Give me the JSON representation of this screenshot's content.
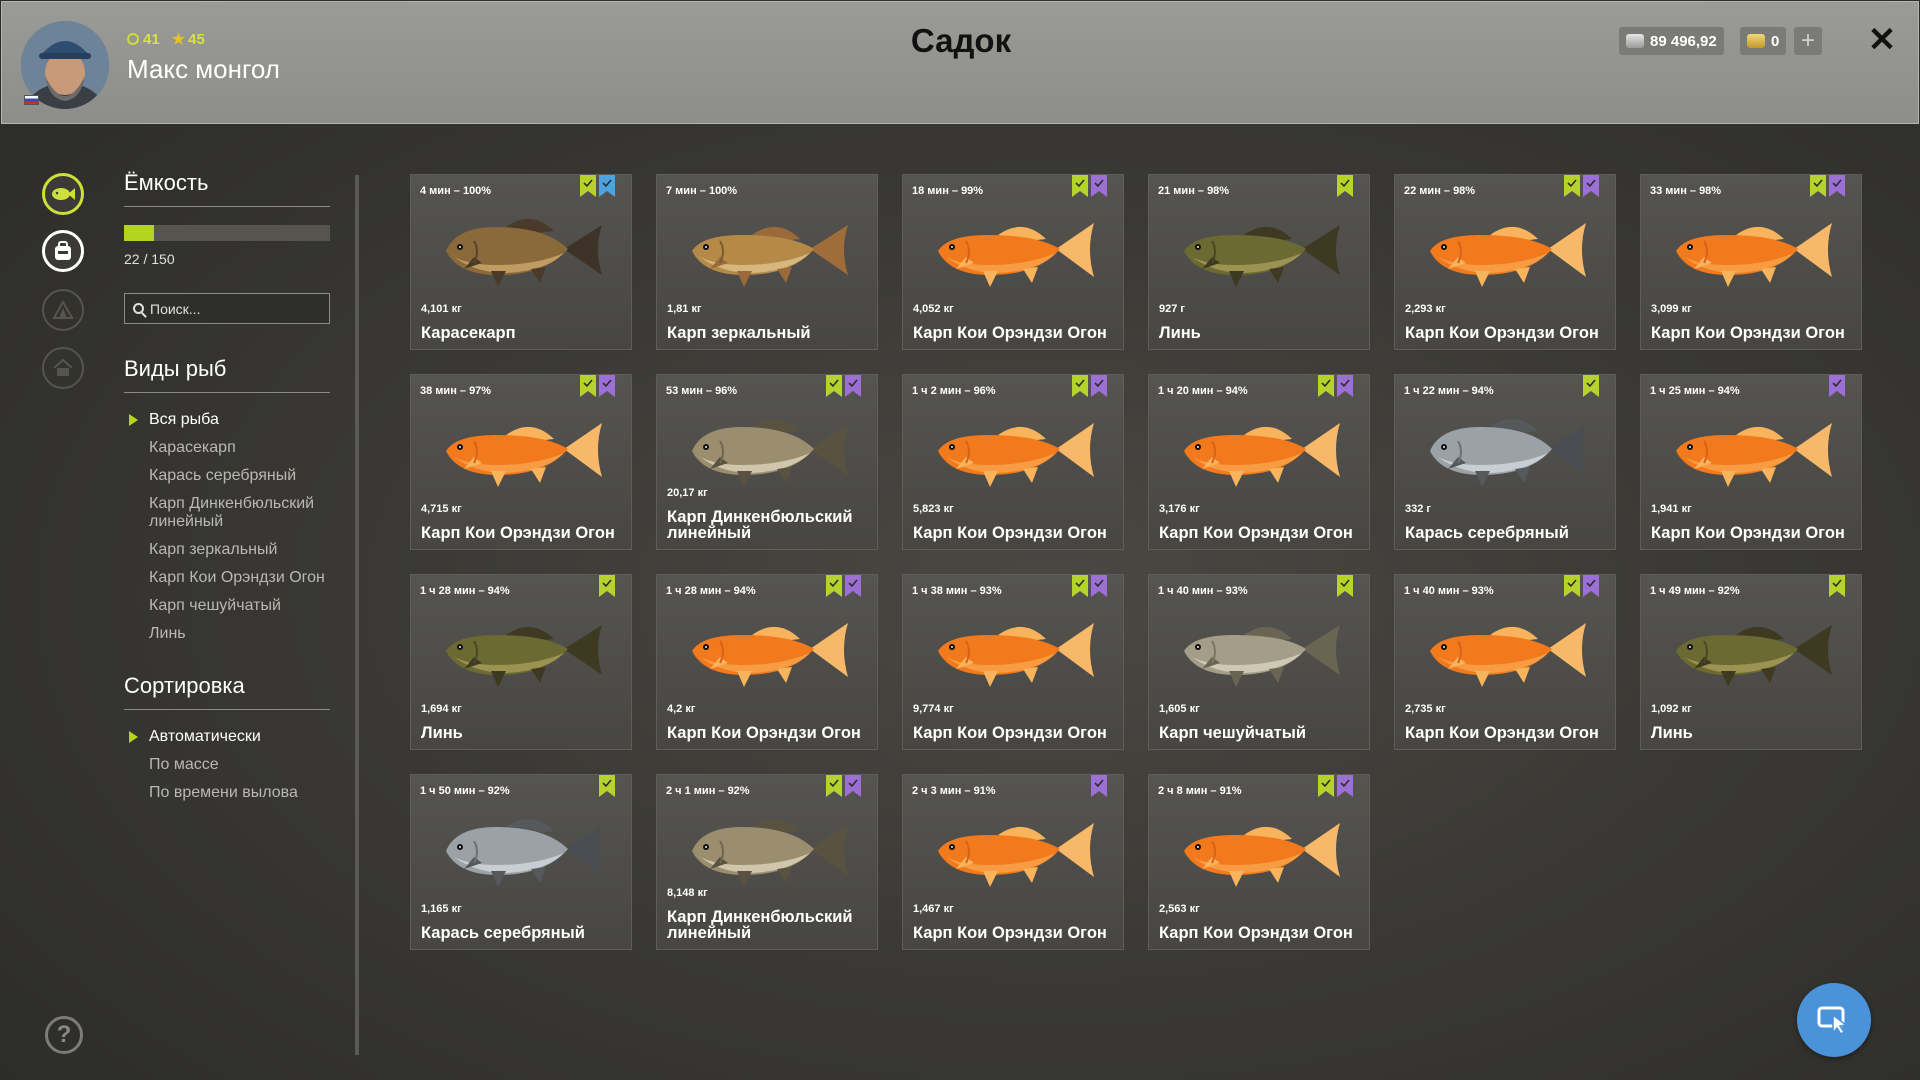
{
  "header": {
    "title": "Садок",
    "player_name": "Макс монгол",
    "level": "41",
    "rank": "45",
    "silver": "89 496,92",
    "gold": "0",
    "add_label": "+",
    "close_label": "✕"
  },
  "capacity": {
    "title": "Ёмкость",
    "used": 22,
    "max": 150,
    "text": "22 / 150"
  },
  "search": {
    "placeholder": "Поиск..."
  },
  "species": {
    "title": "Виды рыб",
    "items": [
      "Вся рыба",
      "Карасекарп",
      "Карась серебряный",
      "Карп Динкенбюльский линейный",
      "Карп зеркальный",
      "Карп Кои Орэндзи Огон",
      "Карп чешуйчатый",
      "Линь"
    ],
    "active_index": 0
  },
  "sorting": {
    "title": "Сортировка",
    "items": [
      "Автоматически",
      "По массе",
      "По времени вылова"
    ],
    "active_index": 0
  },
  "help_label": "?",
  "colors": {
    "accent": "#b5d321",
    "badge_green": "#b6d32b",
    "badge_purple": "#9b6fd6",
    "badge_blue": "#4da3e0",
    "koi": "#f27a1d"
  },
  "fish": [
    {
      "time": "4 мин – 100%",
      "weight": "4,101 кг",
      "name": "Карасекарп",
      "kind": "crucian",
      "badges": [
        "green",
        "blue"
      ]
    },
    {
      "time": "7 мин – 100%",
      "weight": "1,81 кг",
      "name": "Карп зеркальный",
      "kind": "mirror",
      "badges": []
    },
    {
      "time": "18 мин – 99%",
      "weight": "4,052 кг",
      "name": "Карп Кои Орэндзи Огон",
      "kind": "koi",
      "badges": [
        "green",
        "purple"
      ]
    },
    {
      "time": "21 мин – 98%",
      "weight": "927 г",
      "name": "Линь",
      "kind": "tench",
      "badges": [
        "green"
      ]
    },
    {
      "time": "22 мин – 98%",
      "weight": "2,293 кг",
      "name": "Карп Кои Орэндзи Огон",
      "kind": "koi",
      "badges": [
        "green",
        "purple"
      ]
    },
    {
      "time": "33 мин – 98%",
      "weight": "3,099 кг",
      "name": "Карп Кои Орэндзи Огон",
      "kind": "koi",
      "badges": [
        "green",
        "purple"
      ]
    },
    {
      "time": "38 мин – 97%",
      "weight": "4,715 кг",
      "name": "Карп Кои Орэндзи Огон",
      "kind": "koi",
      "badges": [
        "green",
        "purple"
      ]
    },
    {
      "time": "53 мин – 96%",
      "weight": "20,17 кг",
      "name": "Карп Динкенбюльский линейный",
      "kind": "linear",
      "badges": [
        "green",
        "purple"
      ]
    },
    {
      "time": "1 ч 2 мин – 96%",
      "weight": "5,823 кг",
      "name": "Карп Кои Орэндзи Огон",
      "kind": "koi",
      "badges": [
        "green",
        "purple"
      ]
    },
    {
      "time": "1 ч 20 мин – 94%",
      "weight": "3,176 кг",
      "name": "Карп Кои Орэндзи Огон",
      "kind": "koi",
      "badges": [
        "green",
        "purple"
      ]
    },
    {
      "time": "1 ч 22 мин – 94%",
      "weight": "332 г",
      "name": "Карась серебряный",
      "kind": "silver",
      "badges": [
        "green"
      ]
    },
    {
      "time": "1 ч 25 мин – 94%",
      "weight": "1,941 кг",
      "name": "Карп Кои Орэндзи Огон",
      "kind": "koi",
      "badges": [
        "purple"
      ]
    },
    {
      "time": "1 ч 28 мин – 94%",
      "weight": "1,694 кг",
      "name": "Линь",
      "kind": "tench",
      "badges": [
        "green"
      ]
    },
    {
      "time": "1 ч 28 мин – 94%",
      "weight": "4,2 кг",
      "name": "Карп Кои Орэндзи Огон",
      "kind": "koi",
      "badges": [
        "green",
        "purple"
      ]
    },
    {
      "time": "1 ч 38 мин – 93%",
      "weight": "9,774 кг",
      "name": "Карп Кои Орэндзи Огон",
      "kind": "koi",
      "badges": [
        "green",
        "purple"
      ]
    },
    {
      "time": "1 ч 40 мин – 93%",
      "weight": "1,605 кг",
      "name": "Карп чешуйчатый",
      "kind": "common",
      "badges": [
        "green"
      ]
    },
    {
      "time": "1 ч 40 мин – 93%",
      "weight": "2,735 кг",
      "name": "Карп Кои Орэндзи Огон",
      "kind": "koi",
      "badges": [
        "green",
        "purple"
      ]
    },
    {
      "time": "1 ч 49 мин – 92%",
      "weight": "1,092 кг",
      "name": "Линь",
      "kind": "tench",
      "badges": [
        "green"
      ]
    },
    {
      "time": "1 ч 50 мин – 92%",
      "weight": "1,165 кг",
      "name": "Карась серебряный",
      "kind": "silver",
      "badges": [
        "green"
      ]
    },
    {
      "time": "2 ч 1 мин – 92%",
      "weight": "8,148 кг",
      "name": "Карп Динкенбюльский линейный",
      "kind": "linear",
      "badges": [
        "green",
        "purple"
      ]
    },
    {
      "time": "2 ч 3 мин – 91%",
      "weight": "1,467 кг",
      "name": "Карп Кои Орэндзи Огон",
      "kind": "koi",
      "badges": [
        "purple"
      ]
    },
    {
      "time": "2 ч 8 мин – 91%",
      "weight": "2,563 кг",
      "name": "Карп Кои Орэндзи Огон",
      "kind": "koi",
      "badges": [
        "green",
        "purple"
      ]
    }
  ]
}
